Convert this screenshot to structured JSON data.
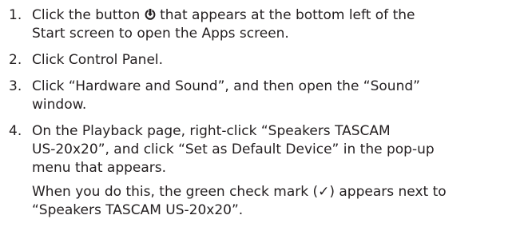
{
  "steps": [
    {
      "number": "1.",
      "line1_before_icon": "Click the button ",
      "icon": "down-arrow-circle-icon",
      "line1_after_icon": " that appears at the bottom left of the",
      "line2": "Start screen to open the Apps screen."
    },
    {
      "number": "2.",
      "line1": "Click Control Panel."
    },
    {
      "number": "3.",
      "line1": "Click “Hardware and Sound”, and then open the “Sound”",
      "line2": "window."
    },
    {
      "number": "4.",
      "line1": "On the Playback page, right-click “Speakers TASCAM",
      "line2": "US-20x20”, and click “Set as Default Device” in the pop-up",
      "line3": "menu that appears."
    }
  ],
  "note": {
    "line1": "When you do this, the green check mark (✓) appears next to",
    "line2": "“Speakers TASCAM US-20x20”."
  }
}
